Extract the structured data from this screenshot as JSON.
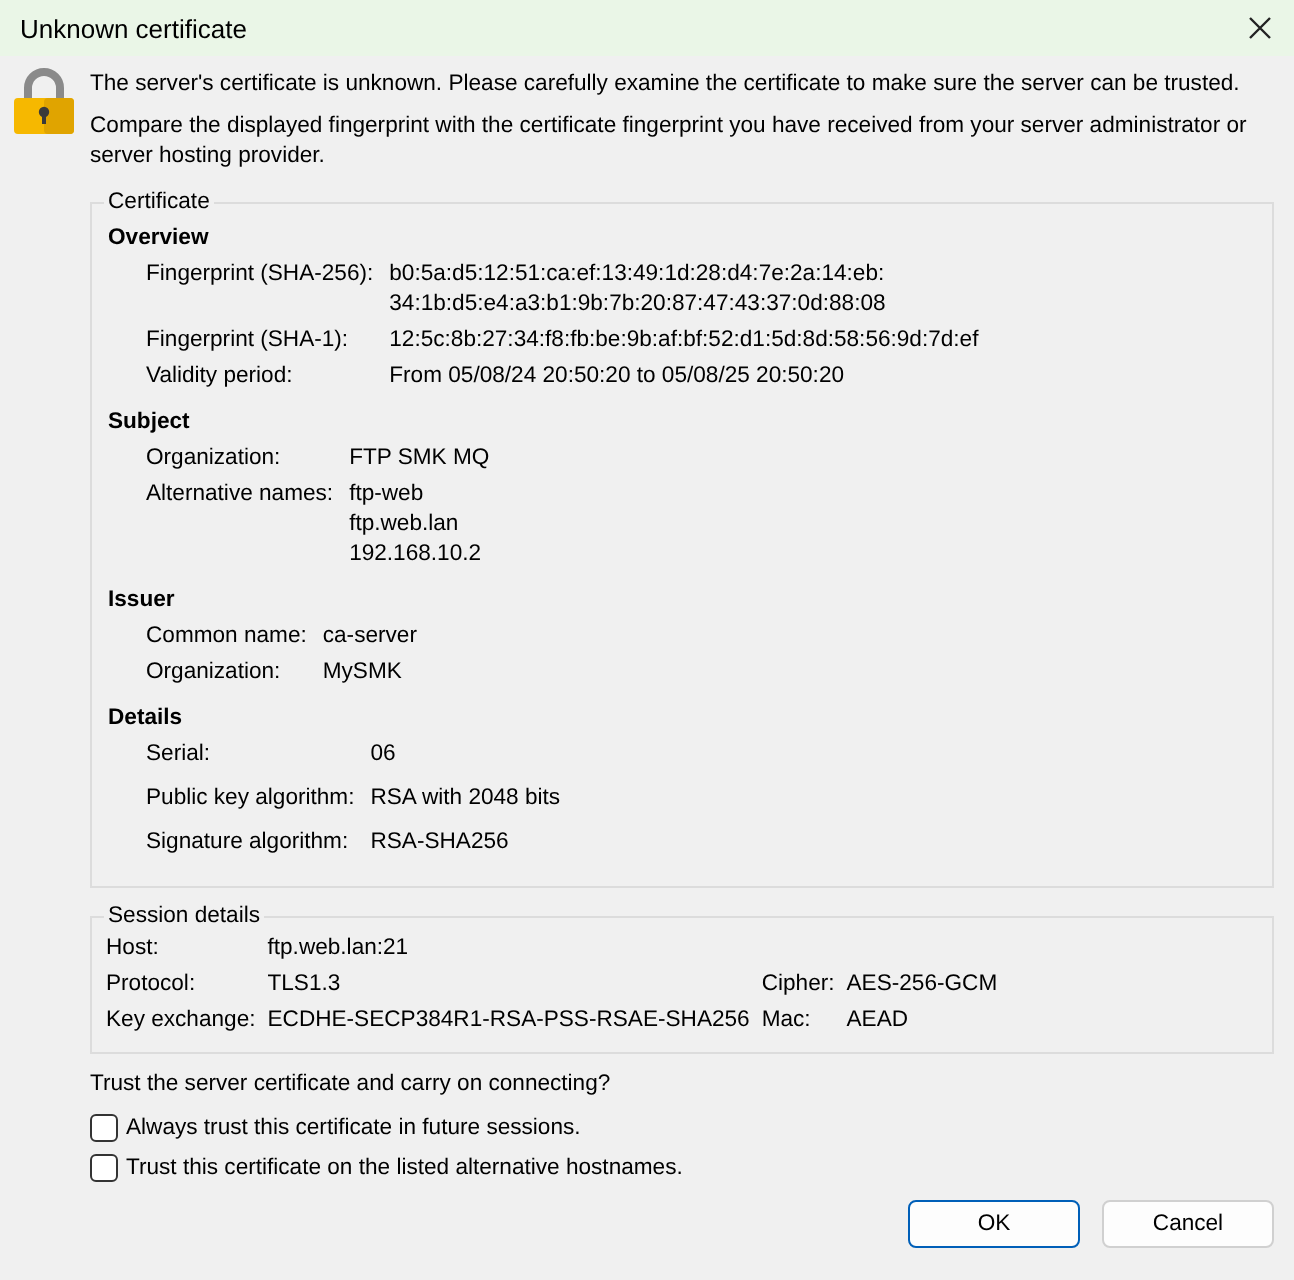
{
  "window": {
    "title": "Unknown certificate"
  },
  "message": [
    "The server's certificate is unknown. Please carefully examine the certificate to make sure the server can be trusted.",
    "Compare the displayed fingerprint with the certificate fingerprint you have received from your server administrator or server hosting provider."
  ],
  "certificate": {
    "title": "Certificate",
    "sections": [
      {
        "heading": "Overview",
        "fields": [
          {
            "label": "Fingerprint (SHA-256):",
            "value": [
              "b0:5a:d5:12:51:ca:ef:13:49:1d:28:d4:7e:2a:14:eb:",
              "34:1b:d5:e4:a3:b1:9b:7b:20:87:47:43:37:0d:88:08"
            ]
          },
          {
            "label": "Fingerprint (SHA-1):",
            "value": [
              "12:5c:8b:27:34:f8:fb:be:9b:af:bf:52:d1:5d:8d:58:56:9d:7d:ef"
            ]
          },
          {
            "label": "Validity period:",
            "value": [
              "From 05/08/24 20:50:20 to 05/08/25 20:50:20"
            ]
          }
        ]
      },
      {
        "heading": "Subject",
        "fields": [
          {
            "label": "Organization:",
            "value": [
              "FTP SMK MQ"
            ]
          },
          {
            "label": "Alternative names:",
            "value": [
              "ftp-web",
              "ftp.web.lan",
              "192.168.10.2"
            ]
          }
        ]
      },
      {
        "heading": "Issuer",
        "fields": [
          {
            "label": "Common name:",
            "value": [
              "ca-server"
            ]
          },
          {
            "label": "Organization:",
            "value": [
              "MySMK"
            ]
          }
        ]
      },
      {
        "heading": "Details",
        "fields": [
          {
            "label": "Serial:",
            "value": [
              "06"
            ]
          },
          {
            "label": "Public key algorithm:",
            "value": [
              "RSA with 2048 bits"
            ]
          },
          {
            "label": "Signature algorithm:",
            "value": [
              "RSA-SHA256"
            ]
          }
        ]
      }
    ]
  },
  "session": {
    "title": "Session details",
    "rows": [
      {
        "label": "Host:",
        "value": "ftp.web.lan:21"
      },
      {
        "label": "Protocol:",
        "value": "TLS1.3",
        "label_2": "Cipher:",
        "value_2": "AES-256-GCM"
      },
      {
        "label": "Key exchange:",
        "value": "ECDHE-SECP384R1-RSA-PSS-RSAE-SHA256",
        "label_2": "Mac:",
        "value_2": "AEAD"
      }
    ]
  },
  "question": "Trust the server certificate and carry on connecting?",
  "options": [
    {
      "label": "Always trust this certificate in future sessions.",
      "checked": false
    },
    {
      "label": "Trust this certificate on the listed alternative hostnames.",
      "checked": false
    }
  ],
  "buttons": [
    {
      "label": "OK",
      "default": true
    },
    {
      "label": "Cancel",
      "default": false
    }
  ]
}
